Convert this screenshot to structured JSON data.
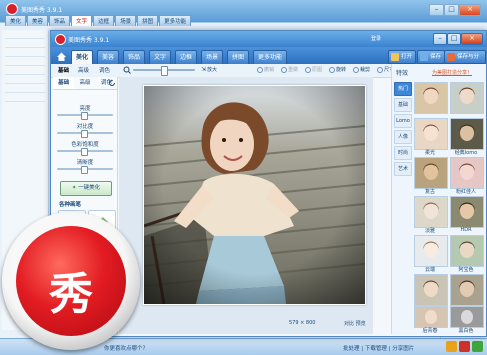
{
  "bg_window": {
    "title": "美图秀秀 3.9.1",
    "tabs": [
      "美化",
      "美容",
      "饰品",
      "文字",
      "边框",
      "场景",
      "拼图",
      "更多功能"
    ],
    "active_tab": "文字",
    "right_links": [
      "登录",
      "打开",
      "保存与分享"
    ],
    "right_panel_title": "特效",
    "status_left": "你更喜欢点哪个？",
    "status_right": "批处理 | 下载管理 | 分享图片"
  },
  "window": {
    "title": "美图秀秀 3.9.1",
    "login": "登录",
    "nav_tabs": [
      "美化",
      "美容",
      "饰品",
      "文字",
      "边框",
      "场景",
      "拼图",
      "更多功能"
    ],
    "active_tab": "美化",
    "open_label": "打开",
    "save_label": "保存",
    "save_share_label": "保存与分享"
  },
  "toolbar": {
    "tabs": [
      "基础",
      "高级",
      "调色"
    ],
    "active": "基础",
    "zoom_in": "放大",
    "items": [
      {
        "label": "撤销",
        "enabled": false
      },
      {
        "label": "重做",
        "enabled": false
      },
      {
        "label": "原图",
        "enabled": false
      },
      {
        "label": "旋转",
        "enabled": true
      },
      {
        "label": "裁剪",
        "enabled": true
      },
      {
        "label": "尺寸",
        "enabled": true
      }
    ]
  },
  "left_panel": {
    "sliders": [
      "亮度",
      "对比度",
      "色彩饱和度",
      "清晰度"
    ],
    "beautify_button": "一键美化",
    "section_title": "各种画笔",
    "tools": [
      "涂鸦笔",
      "消除笔"
    ]
  },
  "canvas": {
    "size_text": "579 × 800",
    "compare_label": "对比",
    "preview_label": "预览"
  },
  "right_panel": {
    "title": "特效",
    "link": "为美图打造分享！",
    "categories": [
      "热门",
      "基础",
      "Lomo",
      "人像",
      "时尚",
      "艺术"
    ],
    "active_category": "热门",
    "effects": [
      "",
      "",
      "柔光",
      "经典lomo",
      "复古",
      "粉红佳人",
      "淡雅",
      "HDR",
      "云端",
      "阿宝色",
      "",
      "",
      "后青春",
      "黑白色"
    ]
  },
  "logo_glyph": "秀",
  "colors": {
    "brand_red": "#e21c22",
    "titlebar_blue": "#3b82cf",
    "panel_bg": "#eef5fc"
  }
}
